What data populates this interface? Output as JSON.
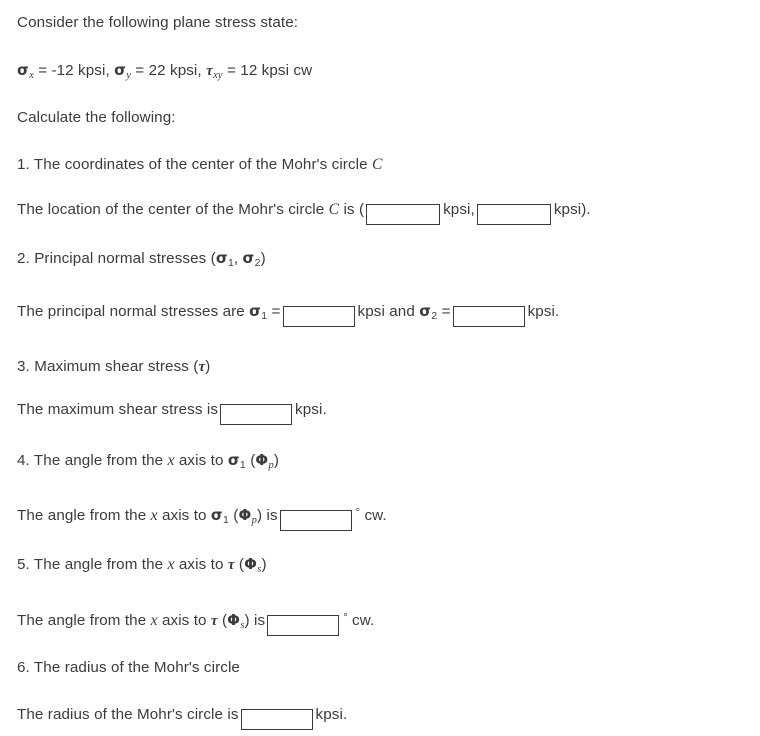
{
  "document": {
    "intro": "Consider the following plane stress state:",
    "given": {
      "sigma_x_symbol": "σ",
      "sigma_x_sub": "x",
      "sigma_x_value": "= -12 kpsi,",
      "sigma_y_symbol": "σ",
      "sigma_y_sub": "y",
      "sigma_y_value": "= 22 kpsi,",
      "tau_xy_symbol": "τ",
      "tau_xy_sub": "xy",
      "tau_xy_value": "= 12 kpsi cw"
    },
    "calculate_label": "Calculate the following:",
    "questions": [
      {
        "number": "1.",
        "prompt_before": "The coordinates of the center of the Mohr's circle",
        "prompt_symbol": "C",
        "answer_parts": {
          "lead": "The location of the center of the Mohr's circle",
          "symbol": "C",
          "is_text": "is (",
          "unit_1": "kpsi,",
          "unit_2": "kpsi).",
          "input_1_value": "",
          "input_2_value": "",
          "input_placeholder": ""
        }
      },
      {
        "number": "2.",
        "prompt_before": "Principal normal stresses (",
        "prompt_sym_1": "σ",
        "prompt_sub_1": "1",
        "prompt_mid": ",",
        "prompt_sym_2": "σ",
        "prompt_sub_2": "2",
        "prompt_after": ")",
        "answer_parts": {
          "lead": "The principal normal stresses are",
          "sym_1": "σ",
          "sub_1": "1",
          "eq_1": "=",
          "unit_1": "kpsi and",
          "sym_2": "σ",
          "sub_2": "2",
          "eq_2": "=",
          "unit_2": "kpsi.",
          "input_1_value": "",
          "input_2_value": ""
        }
      },
      {
        "number": "3.",
        "prompt_before": "Maximum shear stress (",
        "prompt_sym": "τ",
        "prompt_after": ")",
        "answer_parts": {
          "lead": "The maximum shear stress is",
          "unit": "kpsi.",
          "input_value": ""
        }
      },
      {
        "number": "4.",
        "prompt_before": "The angle from the",
        "prompt_axis": "x",
        "prompt_mid": "axis to",
        "prompt_sym": "σ",
        "prompt_sub": "1",
        "prompt_paren_open": "(",
        "prompt_phi": "Φ",
        "prompt_phi_sub": "p",
        "prompt_paren_close": ")",
        "answer_parts": {
          "lead": "The angle from the",
          "axis": "x",
          "mid": "axis to",
          "sym": "σ",
          "sub": "1",
          "paren_open": "(",
          "phi": "Φ",
          "phi_sub": "p",
          "paren_close": ")",
          "is_text": "is",
          "degree": "°",
          "direction": "cw.",
          "input_value": ""
        }
      },
      {
        "number": "5.",
        "prompt_before": "The angle from the",
        "prompt_axis": "x",
        "prompt_mid": "axis to",
        "prompt_sym": "τ",
        "prompt_paren_open": "(",
        "prompt_phi": "Φ",
        "prompt_phi_sub": "s",
        "prompt_paren_close": ")",
        "answer_parts": {
          "lead": "The angle from the",
          "axis": "x",
          "mid": "axis to",
          "sym": "τ",
          "paren_open": "(",
          "phi": "Φ",
          "phi_sub": "s",
          "paren_close": ")",
          "is_text": "is",
          "degree": "°",
          "direction": "cw.",
          "input_value": ""
        }
      },
      {
        "number": "6.",
        "prompt": "The radius of the Mohr's circle",
        "answer_parts": {
          "lead": "The radius of the Mohr's circle is",
          "unit": "kpsi.",
          "input_value": ""
        }
      }
    ]
  },
  "colors": {
    "text": "#3b3b3b",
    "background": "#ffffff",
    "input_border": "#3a3a3a"
  }
}
